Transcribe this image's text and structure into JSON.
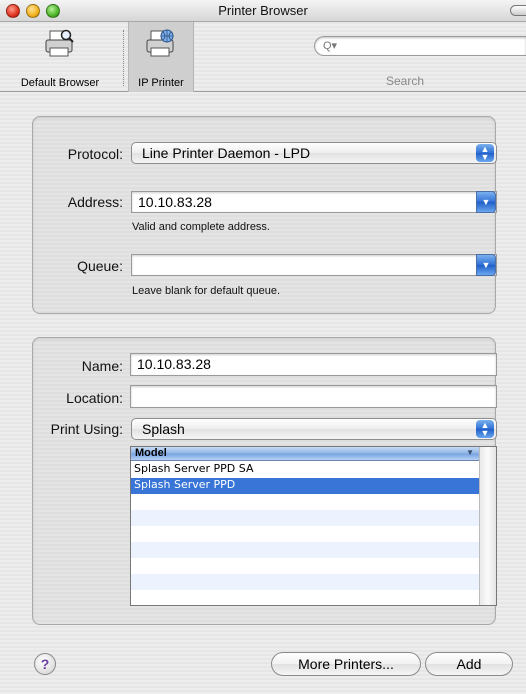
{
  "window": {
    "title": "Printer Browser"
  },
  "toolbar": {
    "default_browser_label": "Default Browser",
    "default_browser_icon": "printer-magnifier-icon",
    "ip_printer_label": "IP Printer",
    "ip_printer_icon": "printer-globe-icon",
    "search_placeholder": "",
    "search_label": "Search"
  },
  "connection": {
    "protocol_label": "Protocol:",
    "protocol_value": "Line Printer Daemon - LPD",
    "address_label": "Address:",
    "address_value": "10.10.83.28",
    "address_hint": "Valid and complete address.",
    "queue_label": "Queue:",
    "queue_value": "",
    "queue_hint": "Leave blank for default queue."
  },
  "details": {
    "name_label": "Name:",
    "name_value": "10.10.83.28",
    "location_label": "Location:",
    "location_value": "",
    "print_using_label": "Print Using:",
    "print_using_value": "Splash"
  },
  "model_table": {
    "header": "Model",
    "rows": [
      "Splash Server PPD SA",
      "Splash Server PPD",
      "",
      "",
      "",
      "",
      "",
      ""
    ],
    "selected_index": 1
  },
  "buttons": {
    "help": "?",
    "more_printers": "More Printers...",
    "add": "Add"
  },
  "colors": {
    "selection": "#3875d7",
    "accent_blue": "#2f6fd6"
  }
}
